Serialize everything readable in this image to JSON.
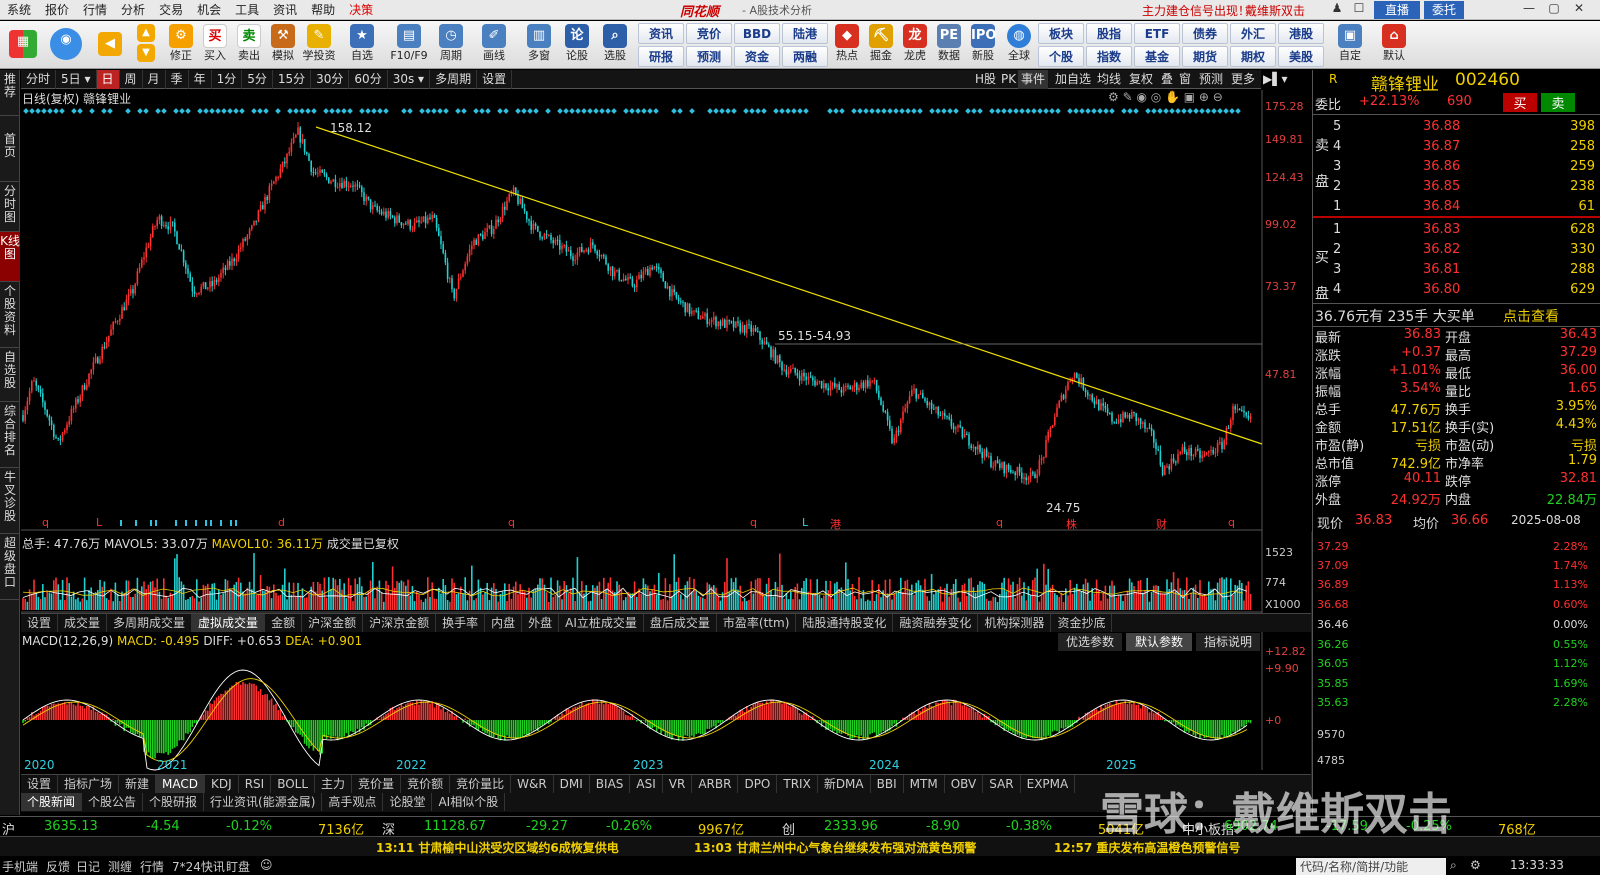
{
  "menu": {
    "items": [
      "系统",
      "报价",
      "行情",
      "分析",
      "交易",
      "机会",
      "工具",
      "资讯",
      "帮助",
      "决策"
    ],
    "brand": "同花顺",
    "brand_sub": "- A股技术分析",
    "ad1": "主力建仓信号出现！",
    "ad2": "戴维斯双击",
    "zhibo": "直播",
    "weituo": "委托"
  },
  "toolbar": {
    "items": [
      "修正",
      "买入",
      "卖出",
      "模拟",
      "学投资",
      "自选",
      "F10/F9",
      "周期",
      "画线",
      "多窗",
      "论股",
      "选股",
      "热点",
      "掘金",
      "龙虎",
      "数据",
      "新股",
      "全球",
      "自定",
      "默认"
    ],
    "small": [
      "资讯",
      "竞价",
      "BBD",
      "陆港",
      "研报",
      "预测",
      "资金",
      "两融",
      "板块",
      "股指",
      "ETF",
      "债券",
      "外汇",
      "港股",
      "个股",
      "指数",
      "基金",
      "期货",
      "期权",
      "美股"
    ]
  },
  "leftbar": [
    "推荐",
    "首页",
    "分时图",
    "K线图",
    "个股资料",
    "自选股",
    "综合排名",
    "牛叉诊股",
    "超级盘口"
  ],
  "periods": [
    "分时",
    "5日",
    "日",
    "周",
    "月",
    "季",
    "年",
    "1分",
    "5分",
    "15分",
    "30分",
    "60分",
    "30s",
    "多周期",
    "设置"
  ],
  "right_buttons": [
    "H股",
    "PK",
    "事件",
    "加自选",
    "均线",
    "复权",
    "叠",
    "窗",
    "预测",
    "更多"
  ],
  "chart": {
    "title": "日线(复权) 赣锋锂业",
    "high_label": "158.12",
    "low_label": "24.75",
    "zone_label": "55.15-54.93",
    "price_axis": [
      "175.28",
      "149.81",
      "124.43",
      "99.02",
      "73.37",
      "47.81"
    ],
    "years": [
      "2020",
      "2021",
      "2022",
      "2023",
      "2024",
      "2025"
    ],
    "markers": [
      "q",
      "L",
      "d",
      "q",
      "q",
      "L",
      "港",
      "q",
      "株",
      "财",
      "q"
    ]
  },
  "volume": {
    "header": "总手: 47.76万",
    "mavol5": "MAVOL5: 33.07万",
    "mavol10": "MAVOL10: 36.11万",
    "note": "成交量已复权",
    "axis": [
      "1523",
      "774"
    ],
    "unit": "X1000"
  },
  "tabs1": [
    "设置",
    "成交量",
    "多周期成交量",
    "虚拟成交量",
    "金额",
    "沪深金额",
    "沪深京金额",
    "换手率",
    "内盘",
    "外盘",
    "AI立桩成交量",
    "盘后成交量",
    "市盈率(ttm)",
    "陆股通持股变化",
    "融资融券变化",
    "机构探测器",
    "资金抄底"
  ],
  "macd": {
    "header": "MACD(12,26,9)",
    "macd": "MACD: -0.495",
    "diff": "DIFF: +0.653",
    "dea": "DEA: +0.901",
    "axis": [
      "+12.82",
      "+9.90",
      "+0"
    ],
    "btns": [
      "优选参数",
      "默认参数",
      "指标说明"
    ]
  },
  "tabs2": [
    "设置",
    "指标广场",
    "新建",
    "MACD",
    "KDJ",
    "RSI",
    "BOLL",
    "主力",
    "竞价量",
    "竞价额",
    "竞价量比",
    "W&R",
    "DMI",
    "BIAS",
    "ASI",
    "VR",
    "ARBR",
    "DPO",
    "TRIX",
    "新DMA",
    "BBI",
    "MTM",
    "OBV",
    "SAR",
    "EXPMA"
  ],
  "tabs3": [
    "个股新闻",
    "个股公告",
    "个股研报",
    "行业资讯(能源金属)",
    "高手观点",
    "论股堂",
    "AI相似个股"
  ],
  "stock": {
    "name": "赣锋锂业",
    "code": "002460",
    "r": "R",
    "weibi_label": "委比",
    "weibi": "+22.13%",
    "weicha": "690",
    "buy": "买",
    "sell": "卖",
    "sell_levels": [
      {
        "n": "5",
        "p": "36.88",
        "v": "398"
      },
      {
        "n": "4",
        "p": "36.87",
        "v": "258"
      },
      {
        "n": "3",
        "p": "36.86",
        "v": "259"
      },
      {
        "n": "2",
        "p": "36.85",
        "v": "238"
      },
      {
        "n": "1",
        "p": "36.84",
        "v": "61"
      }
    ],
    "buy_levels": [
      {
        "n": "1",
        "p": "36.83",
        "v": "628"
      },
      {
        "n": "2",
        "p": "36.82",
        "v": "330"
      },
      {
        "n": "3",
        "p": "36.81",
        "v": "288"
      },
      {
        "n": "4",
        "p": "36.80",
        "v": "629"
      }
    ],
    "sell_side": "卖盘",
    "buy_side": "买盘",
    "bigorder": "36.76元有 235手 大买单",
    "click_view": "点击查看",
    "stats": [
      [
        "最新",
        "36.83",
        "开盘",
        "36.43"
      ],
      [
        "涨跌",
        "+0.37",
        "最高",
        "37.29"
      ],
      [
        "涨幅",
        "+1.01%",
        "最低",
        "36.00"
      ],
      [
        "振幅",
        "3.54%",
        "量比",
        "1.65"
      ],
      [
        "总手",
        "47.76万",
        "换手",
        "3.95%"
      ],
      [
        "金额",
        "17.51亿",
        "换手(实)",
        "4.43%"
      ],
      [
        "市盈(静)",
        "亏损",
        "市盈(动)",
        "亏损"
      ],
      [
        "总市值",
        "742.9亿",
        "市净率",
        "1.79"
      ],
      [
        "涨停",
        "40.11",
        "跌停",
        "32.81"
      ],
      [
        "外盘",
        "24.92万",
        "内盘",
        "22.84万"
      ]
    ],
    "now_label": "现价",
    "now": "36.83",
    "avg_label": "均价",
    "avg": "36.66",
    "date": "2025-08-08",
    "mini_left": [
      "37.29",
      "37.09",
      "36.89",
      "36.68",
      "36.46",
      "36.26",
      "36.05",
      "35.85",
      "35.63",
      "9570",
      "4785"
    ],
    "mini_right": [
      "2.28%",
      "1.74%",
      "1.13%",
      "0.60%",
      "0.00%",
      "0.55%",
      "1.12%",
      "1.69%",
      "2.28%"
    ]
  },
  "indices": [
    {
      "name": "沪",
      "v": "3635.13",
      "c": "-4.54",
      "p": "-0.12%",
      "a": "7136亿"
    },
    {
      "name": "深",
      "v": "11128.67",
      "c": "-29.27",
      "p": "-0.26%",
      "a": "9967亿"
    },
    {
      "name": "创",
      "v": "2333.96",
      "c": "-8.90",
      "p": "-0.38%",
      "a": "5041亿"
    },
    {
      "name": "中小板指",
      "v": "6902.74",
      "c": "-17.59",
      "p": "-0.25%",
      "a": "768亿"
    }
  ],
  "news": [
    "13:11 甘肃榆中山洪受灾区域约6成恢复供电",
    "13:03 甘肃兰州中心气象台继续发布强对流黄色预警",
    "12:57 重庆发布高温橙色预警信号"
  ],
  "bottom": [
    "手机端",
    "反馈",
    "日记",
    "测缠",
    "行情",
    "7*24快讯",
    "盯盘"
  ],
  "search_hint": "代码/名称/简拼/功能",
  "clock": "13:33:33",
  "watermark": "雪球：戴维斯双击",
  "colors": {
    "up": "#ff3030",
    "down": "#20d0d0",
    "trend": "#f0e000"
  }
}
